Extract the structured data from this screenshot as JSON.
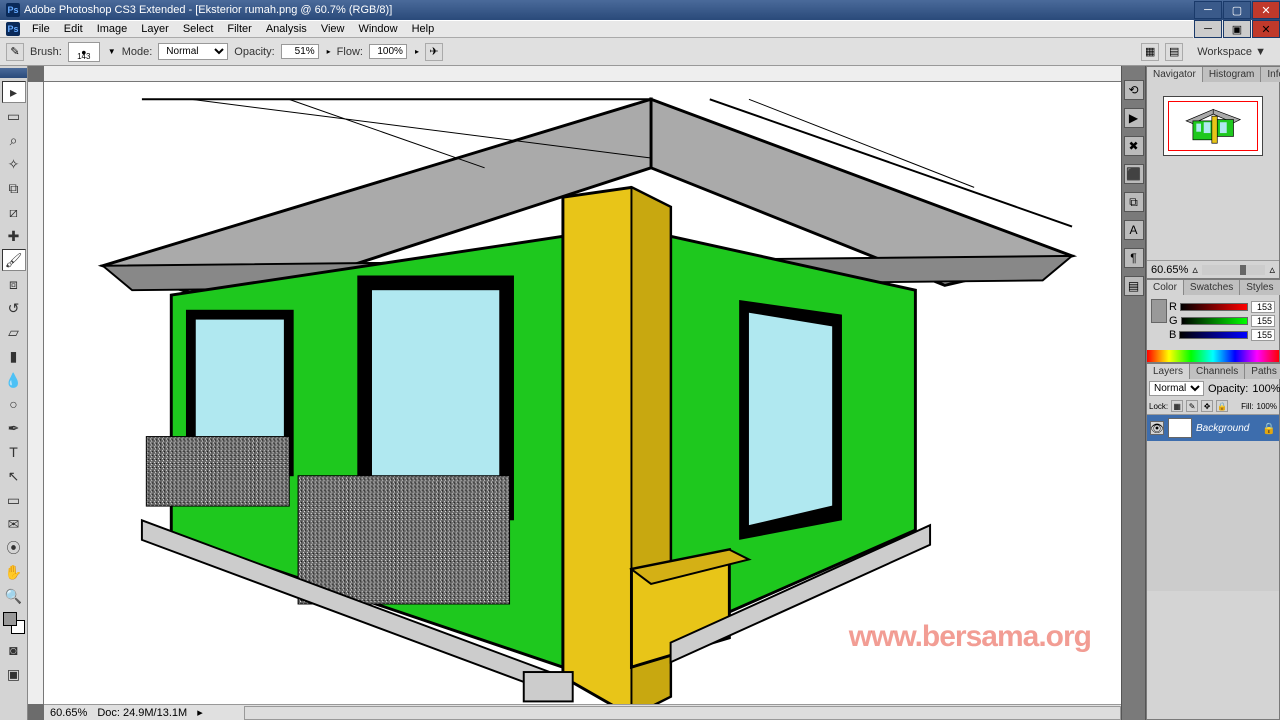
{
  "titlebar": {
    "app": "Adobe Photoshop CS3 Extended",
    "doc": "[Eksterior rumah.png @ 60.7% (RGB/8)]"
  },
  "menu": [
    "File",
    "Edit",
    "Image",
    "Layer",
    "Select",
    "Filter",
    "Analysis",
    "View",
    "Window",
    "Help"
  ],
  "options": {
    "brush_label": "Brush:",
    "brush_size": "143",
    "mode_label": "Mode:",
    "mode_value": "Normal",
    "opacity_label": "Opacity:",
    "opacity_value": "51%",
    "flow_label": "Flow:",
    "flow_value": "100%",
    "workspace": "Workspace ▼"
  },
  "navigator": {
    "tabs": [
      "Navigator",
      "Histogram",
      "Info"
    ],
    "zoom": "60.65%"
  },
  "color": {
    "tabs": [
      "Color",
      "Swatches",
      "Styles"
    ],
    "r_label": "R",
    "r_value": "153",
    "g_label": "G",
    "g_value": "155",
    "b_label": "B",
    "b_value": "155"
  },
  "layers": {
    "tabs": [
      "Layers",
      "Channels",
      "Paths"
    ],
    "blend": "Normal",
    "opacity_label": "Opacity:",
    "opacity": "100%",
    "lock_label": "Lock:",
    "fill_label": "Fill:",
    "fill": "100%",
    "layer_name": "Background"
  },
  "status": {
    "zoom": "60.65%",
    "doc": "Doc: 24.9M/13.1M"
  },
  "watermark": "www.bersama.org"
}
